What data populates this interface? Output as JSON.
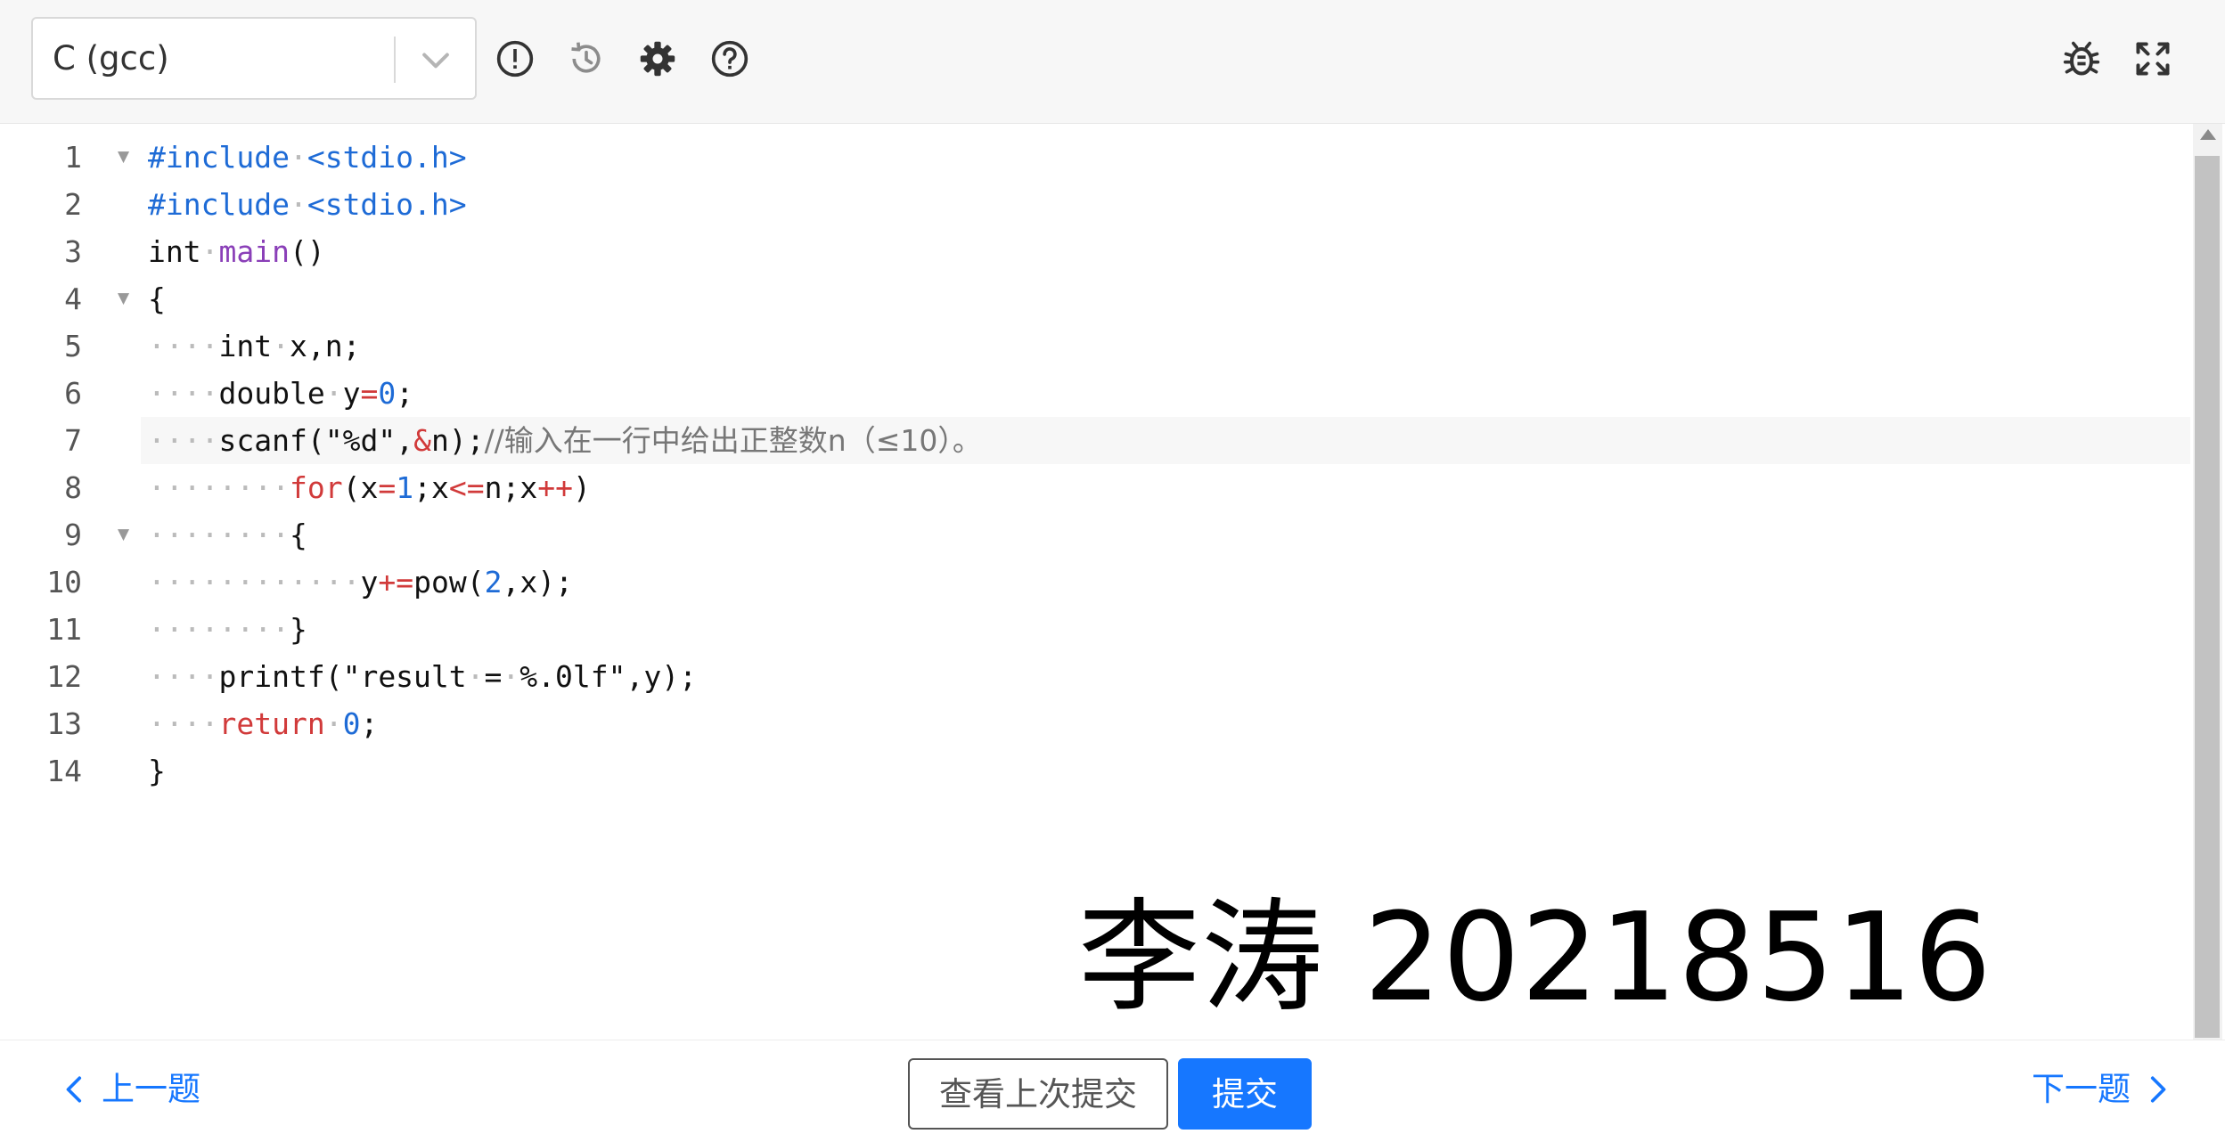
{
  "toolbar": {
    "language": "C (gcc)",
    "icons": [
      "exclamation-icon",
      "history-icon",
      "gear-icon",
      "help-icon",
      "bug-icon",
      "fullscreen-icon"
    ]
  },
  "editor": {
    "line_numbers": [
      "1",
      "2",
      "3",
      "4",
      "5",
      "6",
      "7",
      "8",
      "9",
      "10",
      "11",
      "12",
      "13",
      "14"
    ],
    "lines": [
      "#include <stdio.h>",
      "#include <stdio.h>",
      "int main()",
      "{",
      "    int x,n;",
      "    double y=0;",
      "    scanf(\"%d\",&n);//输入在一行中给出正整数n（≤10）。",
      "        for(x=1;x<=n;x++)",
      "        {",
      "            y+=pow(2,x);",
      "        }",
      "    printf(\"result = %.0lf\",y);",
      "    return 0;",
      "}"
    ],
    "watermark": "李涛 20218516"
  },
  "footer": {
    "prev_label": "上一题",
    "view_last_label": "查看上次提交",
    "submit_label": "提交",
    "next_label": "下一题"
  },
  "colors": {
    "accent": "#1677ff",
    "keyword": "#d13a3a",
    "preprocessor": "#1e6bd6",
    "function": "#8a3fb8",
    "comment": "#777777"
  }
}
